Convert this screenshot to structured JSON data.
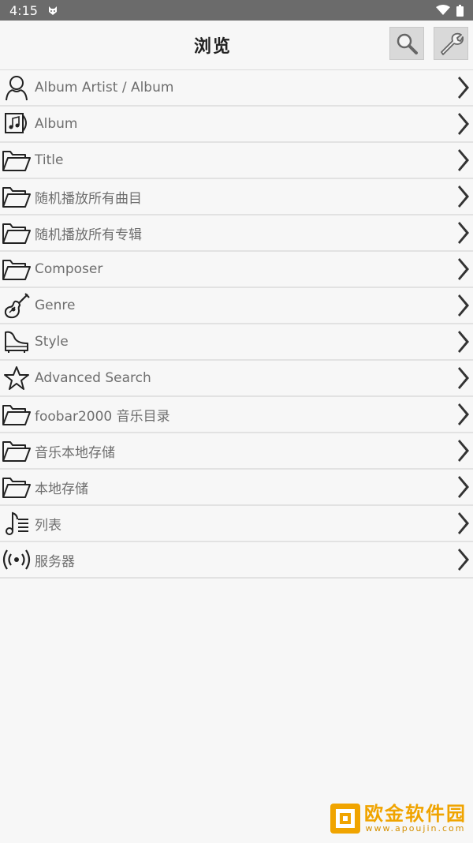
{
  "status": {
    "time": "4:15"
  },
  "header": {
    "title": "浏览"
  },
  "items": [
    {
      "label": "Album Artist / Album",
      "icon": "person-icon"
    },
    {
      "label": "Album",
      "icon": "album-icon"
    },
    {
      "label": "Title",
      "icon": "folder-icon"
    },
    {
      "label": "随机播放所有曲目",
      "icon": "folder-icon"
    },
    {
      "label": "随机播放所有专辑",
      "icon": "folder-icon"
    },
    {
      "label": "Composer",
      "icon": "folder-icon"
    },
    {
      "label": "Genre",
      "icon": "guitar-icon"
    },
    {
      "label": "Style",
      "icon": "piano-icon"
    },
    {
      "label": "Advanced Search",
      "icon": "star-icon"
    },
    {
      "label": "foobar2000 音乐目录",
      "icon": "folder-icon"
    },
    {
      "label": "音乐本地存储",
      "icon": "folder-icon"
    },
    {
      "label": "本地存储",
      "icon": "folder-icon"
    },
    {
      "label": "列表",
      "icon": "playlist-icon"
    },
    {
      "label": "服务器",
      "icon": "broadcast-icon"
    }
  ],
  "watermark": {
    "title": "欧金软件园",
    "subtitle": "www.apoujin.com"
  }
}
